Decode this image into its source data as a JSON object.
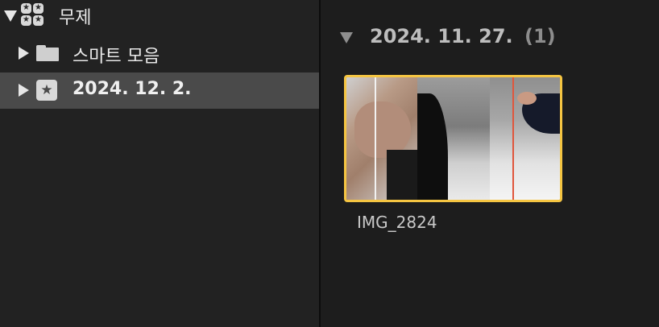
{
  "sidebar": {
    "library": {
      "label": "무제",
      "icon": "library-icon",
      "expanded": true
    },
    "items": [
      {
        "label": "스마트 모음",
        "icon": "folder-icon",
        "selected": false
      },
      {
        "label": "2024. 12. 2.",
        "icon": "event-star-icon",
        "selected": true
      }
    ]
  },
  "browser": {
    "group": {
      "date": "2024. 11. 27.",
      "count": "(1)"
    },
    "clips": [
      {
        "name": "IMG_2824"
      }
    ]
  },
  "colors": {
    "selection_border": "#f5c542",
    "selected_row": "#4a4a4a",
    "playhead": "#e0563c"
  }
}
